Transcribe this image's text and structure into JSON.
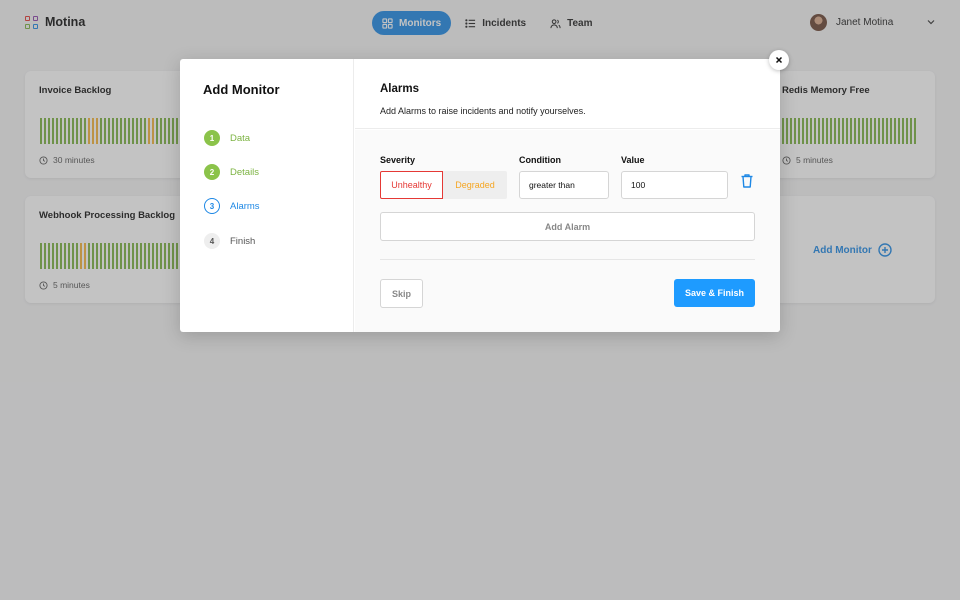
{
  "app": {
    "name": "Motina"
  },
  "nav": {
    "items": [
      {
        "label": "Monitors",
        "icon": "grid-icon",
        "active": true
      },
      {
        "label": "Incidents",
        "icon": "list-icon",
        "active": false
      },
      {
        "label": "Team",
        "icon": "users-icon",
        "active": false
      }
    ]
  },
  "user": {
    "name": "Janet Motina"
  },
  "monitors": [
    {
      "title": "Invoice Backlog",
      "interval": "30 minutes"
    },
    {
      "title": "Redis Memory Free",
      "interval": "5 minutes"
    },
    {
      "title": "Webhook Processing Backlog",
      "interval": "5 minutes"
    }
  ],
  "add_monitor_label": "Add Monitor",
  "modal": {
    "title": "Add Monitor",
    "steps": [
      {
        "num": "1",
        "label": "Data",
        "state": "done"
      },
      {
        "num": "2",
        "label": "Details",
        "state": "done"
      },
      {
        "num": "3",
        "label": "Alarms",
        "state": "current"
      },
      {
        "num": "4",
        "label": "Finish",
        "state": "todo"
      }
    ],
    "section_title": "Alarms",
    "section_desc": "Add Alarms to raise incidents and notify yourselves.",
    "form": {
      "severity_label": "Severity",
      "severity_options": [
        "Unhealthy",
        "Degraded"
      ],
      "severity_selected": "Unhealthy",
      "condition_label": "Condition",
      "condition_value": "greater than",
      "value_label": "Value",
      "value_value": "100"
    },
    "add_alarm_label": "Add Alarm",
    "skip_label": "Skip",
    "save_label": "Save & Finish",
    "close_symbol": "×"
  },
  "colors": {
    "accent": "#1e88e5",
    "healthy": "#7cb342",
    "degraded": "#f5b43a",
    "unhealthy": "#e53935",
    "save": "#1e9bff"
  }
}
